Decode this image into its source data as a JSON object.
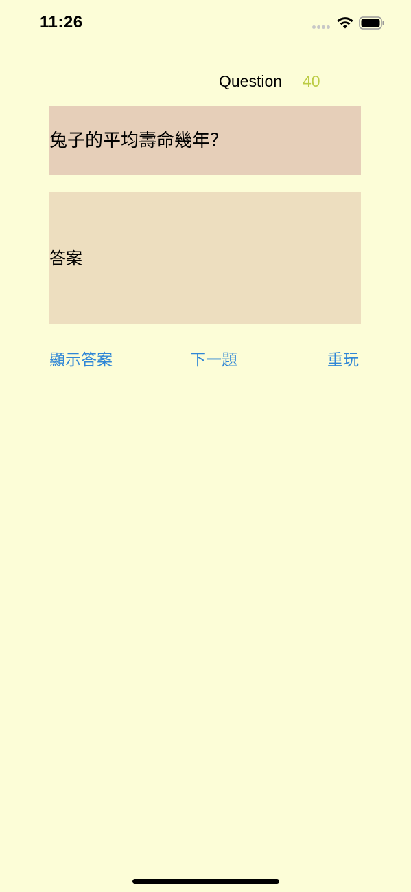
{
  "status_bar": {
    "time": "11:26",
    "wifi_icon": "wifi-icon",
    "battery_icon": "battery-icon",
    "signal_icon": "signal-dots-icon"
  },
  "header": {
    "question_label": "Question",
    "question_number": "40"
  },
  "question": {
    "text": "兔子的平均壽命幾年？"
  },
  "answer": {
    "text": "答案"
  },
  "actions": {
    "show_answer_label": "顯示答案",
    "next_label": "下一題",
    "replay_label": "重玩"
  },
  "colors": {
    "background": "#fcfdd7",
    "question_card": "#e6cfb9",
    "answer_card": "#eddebf",
    "accent_number": "#bccc45",
    "button_text": "#2f86d6"
  }
}
